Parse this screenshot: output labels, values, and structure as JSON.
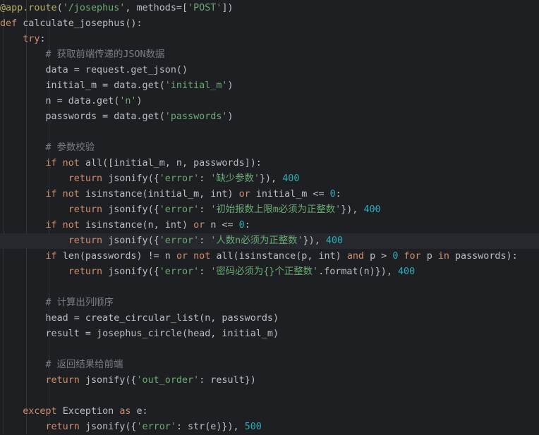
{
  "editor": {
    "theme": {
      "background": "#1e1f22",
      "current_line": "#26282e",
      "keyword": "#cf8e6d",
      "string": "#6aab73",
      "number": "#2aacb8",
      "comment": "#7a7e85",
      "decorator": "#b3ae60",
      "plain": "#bcbec4"
    },
    "caret": {
      "line": 15,
      "token": 9
    },
    "current_line": 15,
    "lines": [
      [
        [
          "dec",
          "@app.route"
        ],
        [
          "plain",
          "("
        ],
        [
          "str",
          "'/josephus'"
        ],
        [
          "plain",
          ", methods=["
        ],
        [
          "str",
          "'POST'"
        ],
        [
          "plain",
          "])"
        ]
      ],
      [
        [
          "kw",
          "def "
        ],
        [
          "plain",
          "calculate_josephus():"
        ]
      ],
      [
        [
          "plain",
          "    "
        ],
        [
          "kw",
          "try"
        ],
        [
          "plain",
          ":"
        ]
      ],
      [
        [
          "plain",
          "        "
        ],
        [
          "cmt",
          "# 获取前端传递的JSON数据"
        ]
      ],
      [
        [
          "plain",
          "        data = request.get_json()"
        ]
      ],
      [
        [
          "plain",
          "        initial_m = data.get("
        ],
        [
          "str",
          "'initial_m'"
        ],
        [
          "plain",
          ")"
        ]
      ],
      [
        [
          "plain",
          "        n = data.get("
        ],
        [
          "str",
          "'n'"
        ],
        [
          "plain",
          ")"
        ]
      ],
      [
        [
          "plain",
          "        passwords = data.get("
        ],
        [
          "str",
          "'passwords'"
        ],
        [
          "plain",
          ")"
        ]
      ],
      [],
      [
        [
          "plain",
          "        "
        ],
        [
          "cmt",
          "# 参数校验"
        ]
      ],
      [
        [
          "plain",
          "        "
        ],
        [
          "kw",
          "if not "
        ],
        [
          "plain",
          "all([initial_m, n, passwords]):"
        ]
      ],
      [
        [
          "plain",
          "            "
        ],
        [
          "kw",
          "return "
        ],
        [
          "plain",
          "jsonify({"
        ],
        [
          "str",
          "'error'"
        ],
        [
          "plain",
          ": "
        ],
        [
          "str",
          "'缺少参数'"
        ],
        [
          "plain",
          "}), "
        ],
        [
          "num",
          "400"
        ]
      ],
      [
        [
          "plain",
          "        "
        ],
        [
          "kw",
          "if not "
        ],
        [
          "plain",
          "isinstance(initial_m, int) "
        ],
        [
          "kw",
          "or "
        ],
        [
          "plain",
          "initial_m <= "
        ],
        [
          "num",
          "0"
        ],
        [
          "plain",
          ":"
        ]
      ],
      [
        [
          "plain",
          "            "
        ],
        [
          "kw",
          "return "
        ],
        [
          "plain",
          "jsonify({"
        ],
        [
          "str",
          "'error'"
        ],
        [
          "plain",
          ": "
        ],
        [
          "str",
          "'初始报数上限m必须为正整数'"
        ],
        [
          "plain",
          "}), "
        ],
        [
          "num",
          "400"
        ]
      ],
      [
        [
          "plain",
          "        "
        ],
        [
          "kw",
          "if not "
        ],
        [
          "plain",
          "isinstance(n, int) "
        ],
        [
          "kw",
          "or "
        ],
        [
          "plain",
          "n <= "
        ],
        [
          "num",
          "0"
        ],
        [
          "plain",
          ":"
        ]
      ],
      [
        [
          "plain",
          "            "
        ],
        [
          "kw",
          "return "
        ],
        [
          "plain",
          "jsonify({"
        ],
        [
          "str",
          "'error'"
        ],
        [
          "plain",
          ": "
        ],
        [
          "str",
          "'人数n必须为正整数'"
        ],
        [
          "plain",
          "}), "
        ],
        [
          "num",
          "400"
        ]
      ],
      [
        [
          "plain",
          "        "
        ],
        [
          "kw",
          "if "
        ],
        [
          "plain",
          "len(passwords) != n "
        ],
        [
          "kw",
          "or not "
        ],
        [
          "plain",
          "all(isinstance(p, int) "
        ],
        [
          "kw",
          "and "
        ],
        [
          "plain",
          "p > "
        ],
        [
          "num",
          "0"
        ],
        [
          "plain",
          " "
        ],
        [
          "kw",
          "for "
        ],
        [
          "plain",
          "p "
        ],
        [
          "kw",
          "in "
        ],
        [
          "plain",
          "passwords):"
        ]
      ],
      [
        [
          "plain",
          "            "
        ],
        [
          "kw",
          "return "
        ],
        [
          "plain",
          "jsonify({"
        ],
        [
          "str",
          "'error'"
        ],
        [
          "plain",
          ": "
        ],
        [
          "str",
          "'密码必须为{}个正整数'"
        ],
        [
          "plain",
          ".format(n)}), "
        ],
        [
          "num",
          "400"
        ]
      ],
      [],
      [
        [
          "plain",
          "        "
        ],
        [
          "cmt",
          "# 计算出列顺序"
        ]
      ],
      [
        [
          "plain",
          "        head = create_circular_list(n, passwords)"
        ]
      ],
      [
        [
          "plain",
          "        result = josephus_circle(head, initial_m)"
        ]
      ],
      [],
      [
        [
          "plain",
          "        "
        ],
        [
          "cmt",
          "# 返回结果给前端"
        ]
      ],
      [
        [
          "plain",
          "        "
        ],
        [
          "kw",
          "return "
        ],
        [
          "plain",
          "jsonify({"
        ],
        [
          "str",
          "'out_order'"
        ],
        [
          "plain",
          ": result})"
        ]
      ],
      [],
      [
        [
          "plain",
          "    "
        ],
        [
          "kw",
          "except "
        ],
        [
          "plain",
          "Exception "
        ],
        [
          "kw",
          "as "
        ],
        [
          "plain",
          "e:"
        ]
      ],
      [
        [
          "plain",
          "        "
        ],
        [
          "kw",
          "return "
        ],
        [
          "plain",
          "jsonify({"
        ],
        [
          "str",
          "'error'"
        ],
        [
          "plain",
          ": str(e)}), "
        ],
        [
          "num",
          "500"
        ]
      ]
    ]
  }
}
